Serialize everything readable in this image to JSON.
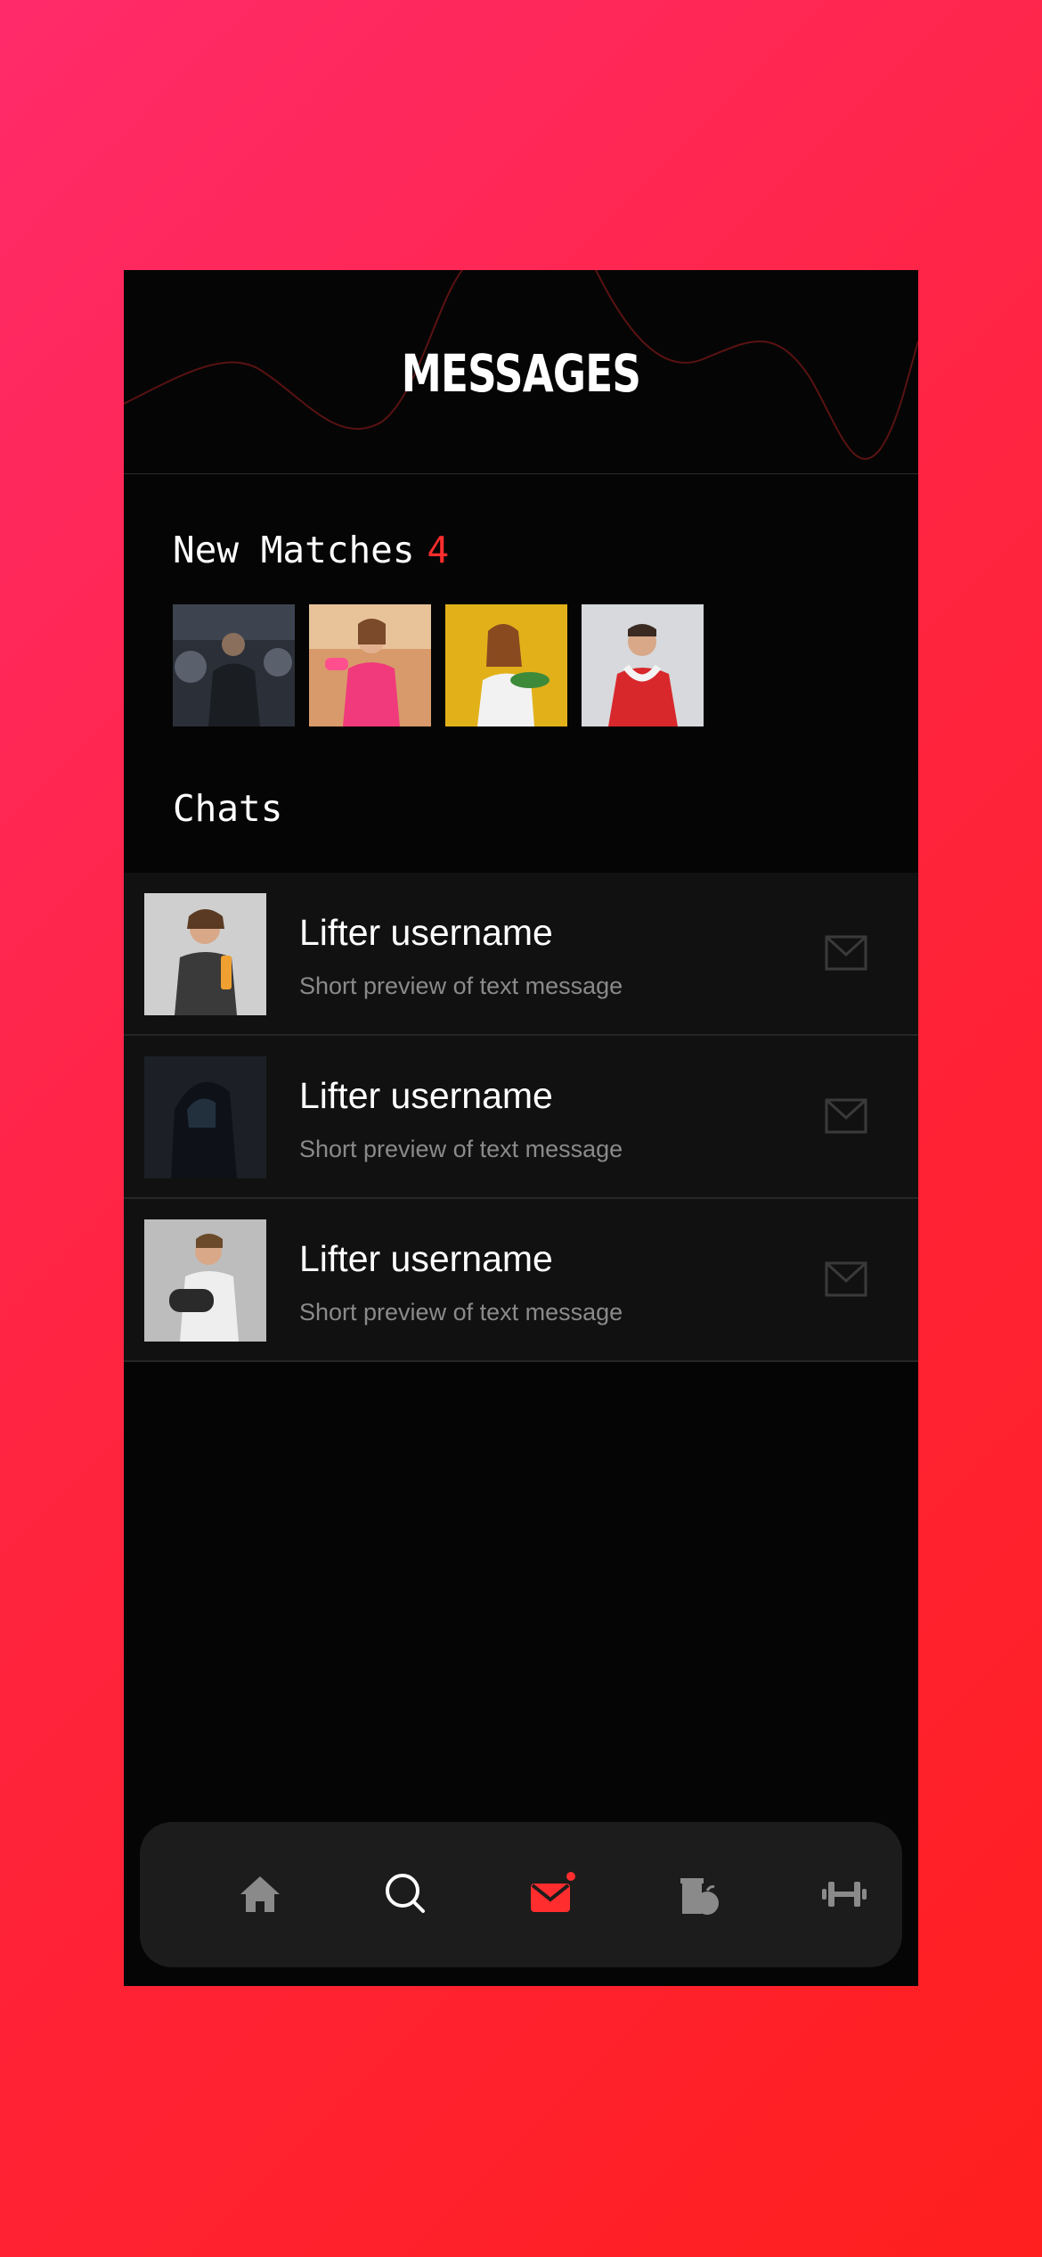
{
  "header": {
    "title": "MESSAGES"
  },
  "new_matches": {
    "label": "New Matches",
    "count": "4",
    "count_color": "#ff2d2d"
  },
  "matches": [
    {
      "icon": "man-gym-photo"
    },
    {
      "icon": "woman-dumbbell-photo"
    },
    {
      "icon": "woman-salad-photo"
    },
    {
      "icon": "man-towel-photo"
    }
  ],
  "chats": {
    "label": "Chats",
    "items": [
      {
        "name": "Lifter username",
        "preview": "Short preview of text message"
      },
      {
        "name": "Lifter username",
        "preview": "Short preview of text message"
      },
      {
        "name": "Lifter username",
        "preview": "Short preview of text message"
      }
    ]
  },
  "nav": {
    "items": [
      "home-icon",
      "search-icon",
      "messages-icon",
      "nutrition-icon",
      "workout-icon"
    ],
    "active": "messages-icon",
    "active_color": "#ff2d2d",
    "inactive_color": "#8a8a8a"
  },
  "colors": {
    "background_start": "#ff2a6a",
    "background_end": "#ff1f1f",
    "panel": "#050505",
    "row": "#111111"
  }
}
